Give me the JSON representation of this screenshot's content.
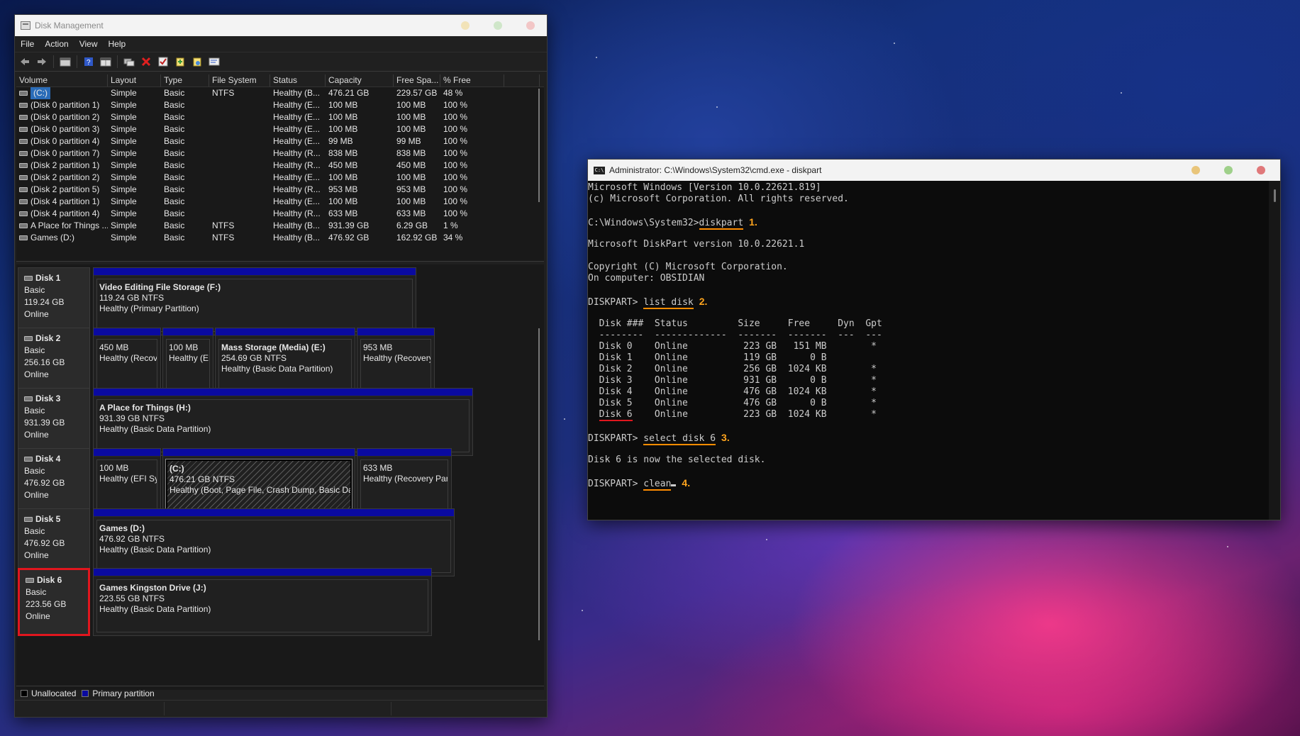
{
  "colors": {
    "accent_orange": "#ffa51e",
    "highlight_red": "#e0161e",
    "primary_partition": "#0a0aa0",
    "selection_blue": "#2a6cb8"
  },
  "disk_management": {
    "title": "Disk Management",
    "menu": [
      "File",
      "Action",
      "View",
      "Help"
    ],
    "toolbar_icons": [
      "back-icon",
      "forward-icon",
      "console-tree-icon",
      "help-icon",
      "properties-grid-icon",
      "connect-icon",
      "delete-icon",
      "check-icon",
      "export-icon",
      "refresh-icon",
      "settings-icon"
    ],
    "columns": [
      "Volume",
      "Layout",
      "Type",
      "File System",
      "Status",
      "Capacity",
      "Free Spa...",
      "% Free"
    ],
    "volumes": [
      {
        "volume": "(C:)",
        "layout": "Simple",
        "type": "Basic",
        "fs": "NTFS",
        "status": "Healthy (B...",
        "capacity": "476.21 GB",
        "free": "229.57 GB",
        "pct": "48 %"
      },
      {
        "volume": "(Disk 0 partition 1)",
        "layout": "Simple",
        "type": "Basic",
        "fs": "",
        "status": "Healthy (E...",
        "capacity": "100 MB",
        "free": "100 MB",
        "pct": "100 %"
      },
      {
        "volume": "(Disk 0 partition 2)",
        "layout": "Simple",
        "type": "Basic",
        "fs": "",
        "status": "Healthy (E...",
        "capacity": "100 MB",
        "free": "100 MB",
        "pct": "100 %"
      },
      {
        "volume": "(Disk 0 partition 3)",
        "layout": "Simple",
        "type": "Basic",
        "fs": "",
        "status": "Healthy (E...",
        "capacity": "100 MB",
        "free": "100 MB",
        "pct": "100 %"
      },
      {
        "volume": "(Disk 0 partition 4)",
        "layout": "Simple",
        "type": "Basic",
        "fs": "",
        "status": "Healthy (E...",
        "capacity": "99 MB",
        "free": "99 MB",
        "pct": "100 %"
      },
      {
        "volume": "(Disk 0 partition 7)",
        "layout": "Simple",
        "type": "Basic",
        "fs": "",
        "status": "Healthy (R...",
        "capacity": "838 MB",
        "free": "838 MB",
        "pct": "100 %"
      },
      {
        "volume": "(Disk 2 partition 1)",
        "layout": "Simple",
        "type": "Basic",
        "fs": "",
        "status": "Healthy (R...",
        "capacity": "450 MB",
        "free": "450 MB",
        "pct": "100 %"
      },
      {
        "volume": "(Disk 2 partition 2)",
        "layout": "Simple",
        "type": "Basic",
        "fs": "",
        "status": "Healthy (E...",
        "capacity": "100 MB",
        "free": "100 MB",
        "pct": "100 %"
      },
      {
        "volume": "(Disk 2 partition 5)",
        "layout": "Simple",
        "type": "Basic",
        "fs": "",
        "status": "Healthy (R...",
        "capacity": "953 MB",
        "free": "953 MB",
        "pct": "100 %"
      },
      {
        "volume": "(Disk 4 partition 1)",
        "layout": "Simple",
        "type": "Basic",
        "fs": "",
        "status": "Healthy (E...",
        "capacity": "100 MB",
        "free": "100 MB",
        "pct": "100 %"
      },
      {
        "volume": "(Disk 4 partition 4)",
        "layout": "Simple",
        "type": "Basic",
        "fs": "",
        "status": "Healthy (R...",
        "capacity": "633 MB",
        "free": "633 MB",
        "pct": "100 %"
      },
      {
        "volume": "A Place for Things ...",
        "layout": "Simple",
        "type": "Basic",
        "fs": "NTFS",
        "status": "Healthy (B...",
        "capacity": "931.39 GB",
        "free": "6.29 GB",
        "pct": "1 %"
      },
      {
        "volume": "Games (D:)",
        "layout": "Simple",
        "type": "Basic",
        "fs": "NTFS",
        "status": "Healthy (B...",
        "capacity": "476.92 GB",
        "free": "162.92 GB",
        "pct": "34 %"
      }
    ],
    "disks": [
      {
        "name": "Disk 1",
        "type": "Basic",
        "size": "119.24 GB",
        "state": "Online",
        "partitions": [
          {
            "title": "Video Editing File Storage  (F:)",
            "size": "119.24 GB NTFS",
            "status": "Healthy (Primary Partition)"
          }
        ]
      },
      {
        "name": "Disk 2",
        "type": "Basic",
        "size": "256.16 GB",
        "state": "Online",
        "partitions": [
          {
            "title": "",
            "size": "450 MB",
            "status": "Healthy (Recovery"
          },
          {
            "title": "",
            "size": "100 MB",
            "status": "Healthy (EFI S"
          },
          {
            "title": "Mass Storage (Media)  (E:)",
            "size": "254.69 GB NTFS",
            "status": "Healthy (Basic Data Partition)"
          },
          {
            "title": "",
            "size": "953 MB",
            "status": "Healthy (Recovery Par"
          }
        ]
      },
      {
        "name": "Disk 3",
        "type": "Basic",
        "size": "931.39 GB",
        "state": "Online",
        "partitions": [
          {
            "title": "A Place for Things  (H:)",
            "size": "931.39 GB NTFS",
            "status": "Healthy (Basic Data Partition)"
          }
        ]
      },
      {
        "name": "Disk 4",
        "type": "Basic",
        "size": "476.92 GB",
        "state": "Online",
        "partitions": [
          {
            "title": "",
            "size": "100 MB",
            "status": "Healthy (EFI Syster"
          },
          {
            "title": "(C:)",
            "size": "476.21 GB NTFS",
            "status": "Healthy (Boot, Page File, Crash Dump, Basic Data Partition)"
          },
          {
            "title": "",
            "size": "633 MB",
            "status": "Healthy (Recovery Partition"
          }
        ]
      },
      {
        "name": "Disk 5",
        "type": "Basic",
        "size": "476.92 GB",
        "state": "Online",
        "partitions": [
          {
            "title": "Games  (D:)",
            "size": "476.92 GB NTFS",
            "status": "Healthy (Basic Data Partition)"
          }
        ]
      },
      {
        "name": "Disk 6",
        "type": "Basic",
        "size": "223.56 GB",
        "state": "Online",
        "partitions": [
          {
            "title": "Games Kingston Drive  (J:)",
            "size": "223.55 GB NTFS",
            "status": "Healthy (Basic Data Partition)"
          }
        ]
      }
    ],
    "legend": {
      "unallocated": "Unallocated",
      "primary": "Primary partition"
    }
  },
  "cmd": {
    "title": "Administrator: C:\\Windows\\System32\\cmd.exe - diskpart",
    "lines": [
      "Microsoft Windows [Version 10.0.22621.819]",
      "(c) Microsoft Corporation. All rights reserved.",
      "",
      "C:\\Windows\\System32>",
      "",
      "Microsoft DiskPart version 10.0.22621.1",
      "",
      "Copyright (C) Microsoft Corporation.",
      "On computer: OBSIDIAN",
      "",
      "DISKPART> ",
      "",
      "  Disk ###  Status         Size     Free     Dyn  Gpt",
      "  --------  -------------  -------  -------  ---  ---",
      "  Disk 0    Online          223 GB   151 MB        *",
      "  Disk 1    Online          119 GB      0 B",
      "  Disk 2    Online          256 GB  1024 KB        *",
      "  Disk 3    Online          931 GB      0 B        *",
      "  Disk 4    Online          476 GB  1024 KB        *",
      "  Disk 5    Online          476 GB      0 B        *",
      "  ",
      "",
      "DISKPART> ",
      "",
      "Disk 6 is now the selected disk.",
      "",
      "DISKPART> "
    ],
    "cmd_diskpart": "diskpart",
    "cmd_list": "list disk",
    "cmd_select": "select disk 6",
    "cmd_clean": "clean",
    "disk6_name": "Disk 6",
    "disk6_rest": "    Online          223 GB  1024 KB        *",
    "steps": [
      "1.",
      "2.",
      "3.",
      "4."
    ]
  }
}
